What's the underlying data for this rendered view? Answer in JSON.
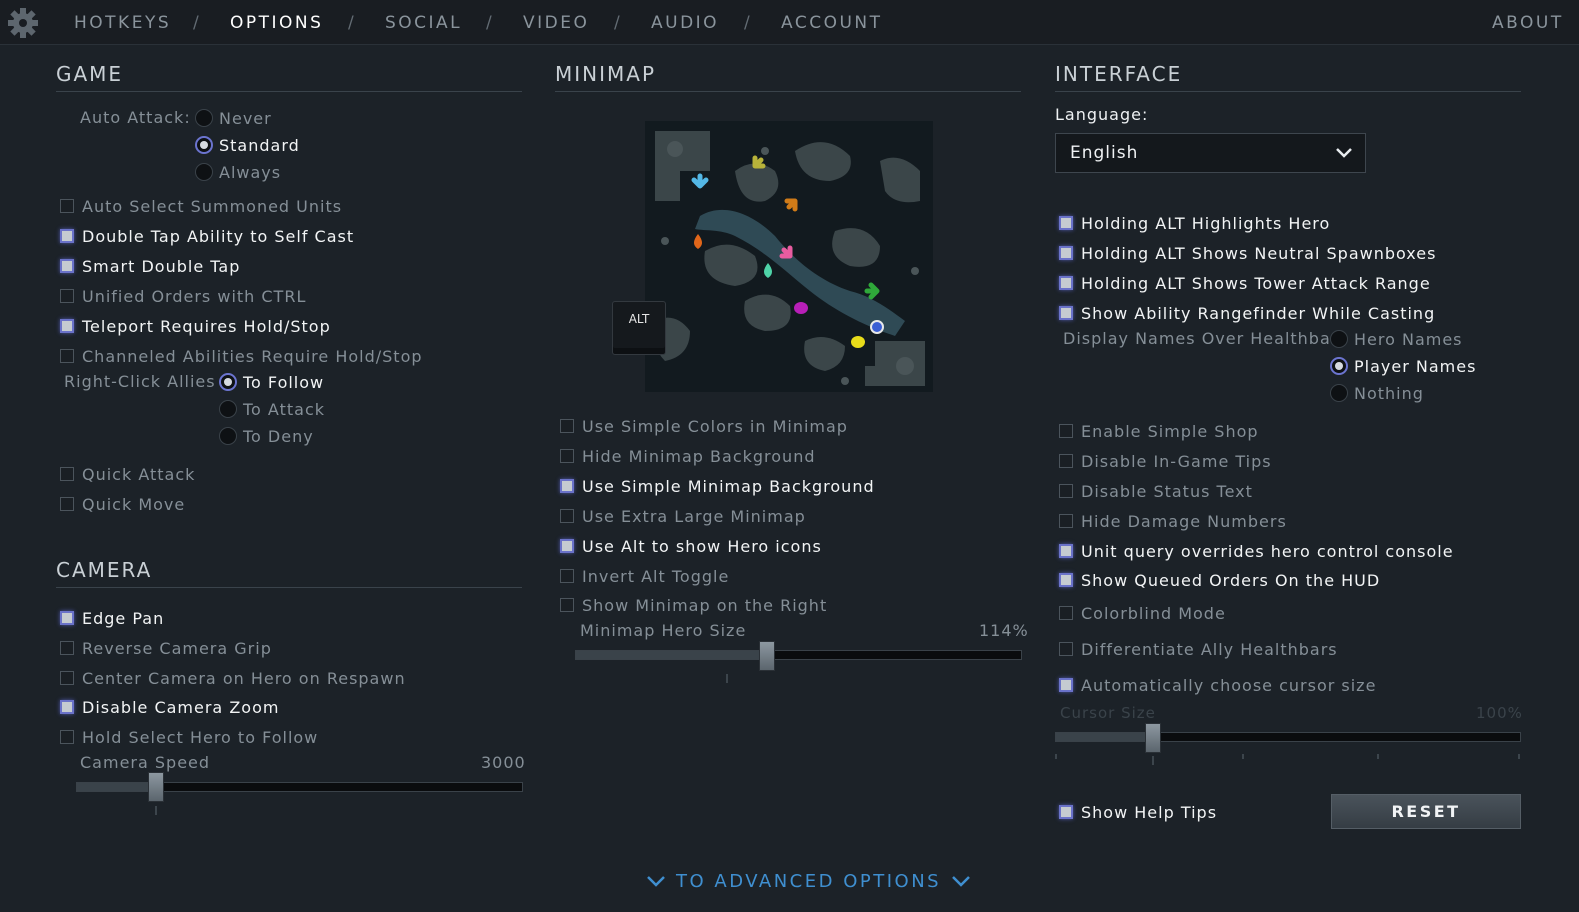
{
  "nav": {
    "tabs": [
      "HOTKEYS",
      "OPTIONS",
      "SOCIAL",
      "VIDEO",
      "AUDIO",
      "ACCOUNT"
    ],
    "active_tab": "OPTIONS",
    "separator": "/",
    "about": "ABOUT"
  },
  "game": {
    "title": "GAME",
    "auto_attack_label": "Auto Attack:",
    "auto_attack_options": [
      "Never",
      "Standard",
      "Always"
    ],
    "auto_attack_selected": "Standard",
    "checkboxes": [
      {
        "label": "Auto Select Summoned Units",
        "checked": false
      },
      {
        "label": "Double Tap Ability to Self Cast",
        "checked": true
      },
      {
        "label": "Smart Double Tap",
        "checked": true
      },
      {
        "label": "Unified Orders with CTRL",
        "checked": false
      },
      {
        "label": "Teleport Requires Hold/Stop",
        "checked": true
      },
      {
        "label": "Channeled Abilities Require Hold/Stop",
        "checked": false
      }
    ],
    "right_click_label": "Right-Click Allies",
    "right_click_options": [
      "To Follow",
      "To Attack",
      "To Deny"
    ],
    "right_click_selected": "To Follow",
    "quick": [
      {
        "label": "Quick Attack",
        "checked": false
      },
      {
        "label": "Quick Move",
        "checked": false
      }
    ]
  },
  "camera": {
    "title": "CAMERA",
    "checkboxes": [
      {
        "label": "Edge Pan",
        "checked": true
      },
      {
        "label": "Reverse Camera Grip",
        "checked": false
      },
      {
        "label": "Center Camera on Hero on Respawn",
        "checked": false
      },
      {
        "label": "Disable Camera Zoom",
        "checked": true
      },
      {
        "label": "Hold Select Hero to Follow",
        "checked": false
      }
    ],
    "speed_label": "Camera Speed",
    "speed_value": "3000",
    "speed_fraction": 0.18
  },
  "minimap": {
    "title": "MINIMAP",
    "alt_key": "ALT",
    "checkboxes": [
      {
        "label": "Use Simple Colors in Minimap",
        "checked": false
      },
      {
        "label": "Hide Minimap Background",
        "checked": false
      },
      {
        "label": "Use Simple Minimap Background",
        "checked": true
      },
      {
        "label": "Use Extra Large Minimap",
        "checked": false
      },
      {
        "label": "Use Alt to show Hero icons",
        "checked": true
      },
      {
        "label": "Invert Alt Toggle",
        "checked": false
      },
      {
        "label": "Show Minimap on the Right",
        "checked": false
      }
    ],
    "hero_size_label": "Minimap Hero Size",
    "hero_size_value": "114%",
    "hero_size_fraction": 0.43
  },
  "interface": {
    "title": "INTERFACE",
    "language_label": "Language:",
    "language_value": "English",
    "checkboxes": [
      {
        "label": "Holding ALT Highlights Hero",
        "checked": true
      },
      {
        "label": "Holding ALT Shows Neutral Spawnboxes",
        "checked": true
      },
      {
        "label": "Holding ALT Shows Tower Attack Range",
        "checked": true
      },
      {
        "label": "Show Ability Rangefinder While Casting",
        "checked": true
      }
    ],
    "display_names_label": "Display Names Over Healthbar",
    "display_names_options": [
      "Hero Names",
      "Player Names",
      "Nothing"
    ],
    "display_names_selected": "Player Names",
    "more_checkboxes": [
      {
        "label": "Enable Simple Shop",
        "checked": false
      },
      {
        "label": "Disable In-Game Tips",
        "checked": false
      },
      {
        "label": "Disable Status Text",
        "checked": false
      },
      {
        "label": "Hide Damage Numbers",
        "checked": false
      },
      {
        "label": "Unit query overrides hero control console",
        "checked": true
      },
      {
        "label": "Show Queued Orders On the HUD",
        "checked": true
      },
      {
        "label": "Colorblind Mode",
        "checked": false
      },
      {
        "label": "Differentiate Ally Healthbars",
        "checked": false
      },
      {
        "label": "Automatically choose cursor size",
        "checked": true
      }
    ],
    "cursor_size_label": "Cursor Size",
    "cursor_size_value": "100%",
    "cursor_size_fraction": 0.21,
    "help_tips": {
      "label": "Show Help Tips",
      "checked": true
    },
    "reset_label": "RESET"
  },
  "advanced_label": "TO ADVANCED OPTIONS"
}
